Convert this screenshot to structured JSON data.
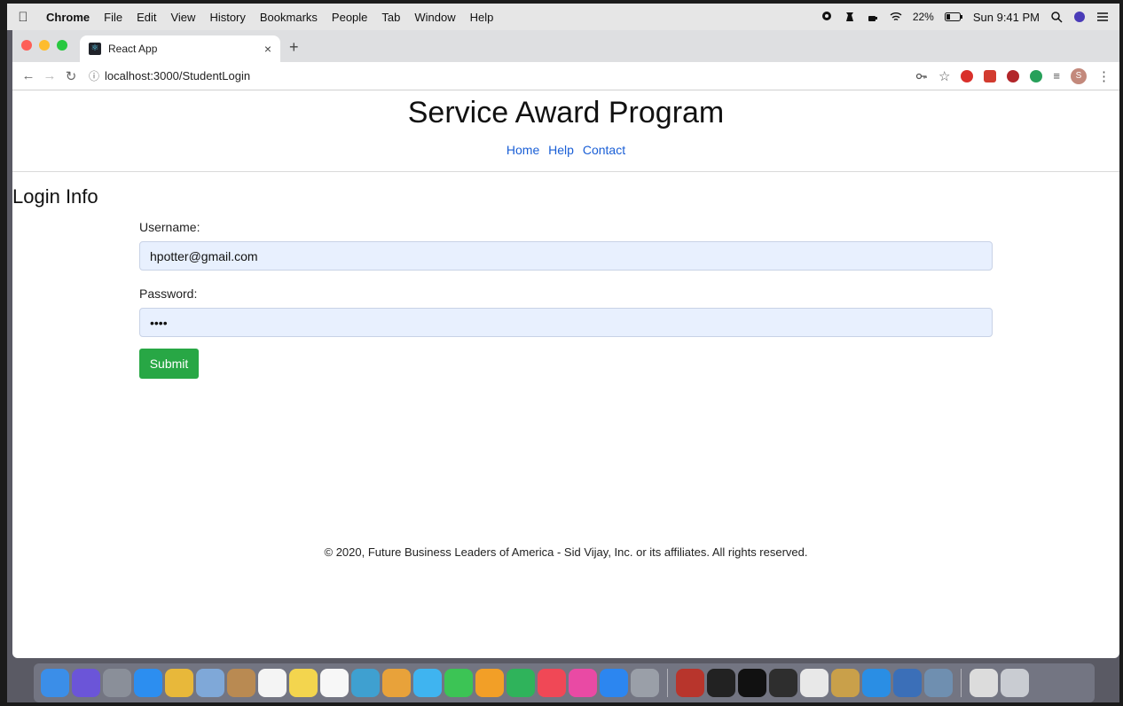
{
  "menubar": {
    "apple_icon": "apple-icon",
    "items": [
      "Chrome",
      "File",
      "Edit",
      "View",
      "History",
      "Bookmarks",
      "People",
      "Tab",
      "Window",
      "Help"
    ],
    "battery": "22%",
    "clock": "Sun 9:41 PM"
  },
  "browser": {
    "tab_title": "React App",
    "tab_close": "×",
    "new_tab": "+",
    "url": "localhost:3000/StudentLogin",
    "profile_initial": "S",
    "colors": {
      "traffic_red": "#fe5f57",
      "traffic_yellow": "#febc2e",
      "traffic_green": "#28c840"
    }
  },
  "page": {
    "title": "Service Award Program",
    "nav": {
      "home": "Home",
      "help": "Help",
      "contact": "Contact"
    },
    "form": {
      "heading": "Login Info",
      "username_label": "Username:",
      "username_value": "hpotter@gmail.com",
      "password_label": "Password:",
      "password_value": "abcd",
      "submit_label": "Submit"
    },
    "footer": "© 2020, Future Business Leaders of America - Sid Vijay, Inc. or its affiliates. All rights reserved.",
    "colors": {
      "link": "#1a5fd6",
      "submit_bg": "#28a745",
      "input_bg": "#e8f0fe"
    }
  },
  "dock": {
    "icons": [
      {
        "name": "finder-icon",
        "color": "#3b8ee8"
      },
      {
        "name": "siri-icon",
        "color": "#6b55d8"
      },
      {
        "name": "launchpad-icon",
        "color": "#8a8f99"
      },
      {
        "name": "safari-icon",
        "color": "#2c8ef0"
      },
      {
        "name": "chrome-icon",
        "color": "#e8b83a"
      },
      {
        "name": "preview-icon",
        "color": "#7fa8d8"
      },
      {
        "name": "notebook-icon",
        "color": "#b98a52"
      },
      {
        "name": "calendar-icon",
        "color": "#f4f4f4"
      },
      {
        "name": "notes-icon",
        "color": "#f3d54e"
      },
      {
        "name": "reminders-icon",
        "color": "#f7f7f7"
      },
      {
        "name": "photo-booth-icon",
        "color": "#3fa0d0"
      },
      {
        "name": "photos-icon",
        "color": "#e8a23a"
      },
      {
        "name": "messages-icon",
        "color": "#3fb4f0"
      },
      {
        "name": "facetime-icon",
        "color": "#3cc455"
      },
      {
        "name": "pages-icon",
        "color": "#f29f27"
      },
      {
        "name": "numbers-icon",
        "color": "#2fb35b"
      },
      {
        "name": "news-icon",
        "color": "#f04856"
      },
      {
        "name": "itunes-icon",
        "color": "#e94aa4"
      },
      {
        "name": "app-store-icon",
        "color": "#2c86f0"
      },
      {
        "name": "system-preferences-icon",
        "color": "#9a9fa8"
      },
      {
        "name": "separator"
      },
      {
        "name": "dictionary-icon",
        "color": "#b8352c"
      },
      {
        "name": "terminal-icon",
        "color": "#222222"
      },
      {
        "name": "intellij-icon",
        "color": "#111111"
      },
      {
        "name": "activity-monitor-icon",
        "color": "#2e2e2e"
      },
      {
        "name": "textedit-icon",
        "color": "#e8e8e8"
      },
      {
        "name": "keychain-icon",
        "color": "#c9a04a"
      },
      {
        "name": "vscode-icon",
        "color": "#2a8ee4"
      },
      {
        "name": "quicktime-icon",
        "color": "#3b6fb8"
      },
      {
        "name": "screenshot-icon",
        "color": "#6f8fb0"
      },
      {
        "name": "separator"
      },
      {
        "name": "windows-icon",
        "color": "#dcdcdc"
      },
      {
        "name": "trash-icon",
        "color": "#c9ccd2"
      }
    ]
  }
}
